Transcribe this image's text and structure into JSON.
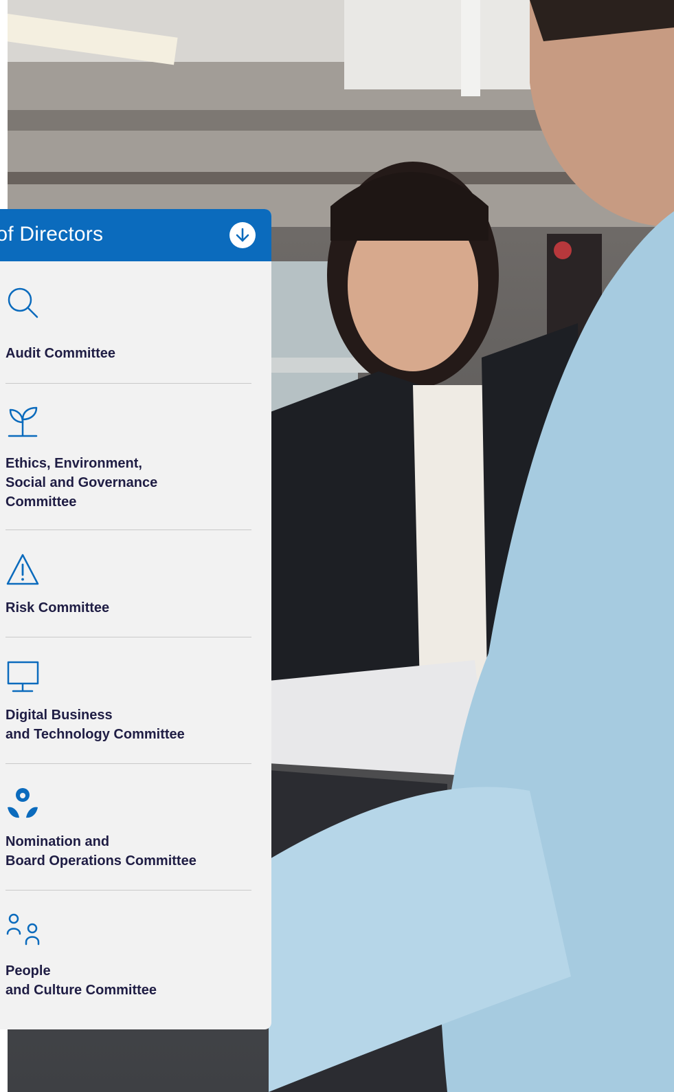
{
  "panel": {
    "title": "d of Directors",
    "expand_icon": "arrow-down-circle-icon",
    "accent_color": "#0b6bbd",
    "text_color": "#1f1d44"
  },
  "committees": [
    {
      "icon": "magnifier-icon",
      "lines": [
        "Audit Committee"
      ]
    },
    {
      "icon": "sprout-icon",
      "lines": [
        "Ethics, Environment,",
        "Social and Governance",
        "Committee"
      ]
    },
    {
      "icon": "warning-triangle-icon",
      "lines": [
        "Risk Committee"
      ]
    },
    {
      "icon": "monitor-icon",
      "lines": [
        "Digital Business",
        "and Technology Committee"
      ]
    },
    {
      "icon": "nomination-icon",
      "lines": [
        "Nomination and",
        "Board Operations Committee"
      ]
    },
    {
      "icon": "people-icon",
      "lines": [
        "People",
        "and Culture Committee"
      ]
    }
  ]
}
